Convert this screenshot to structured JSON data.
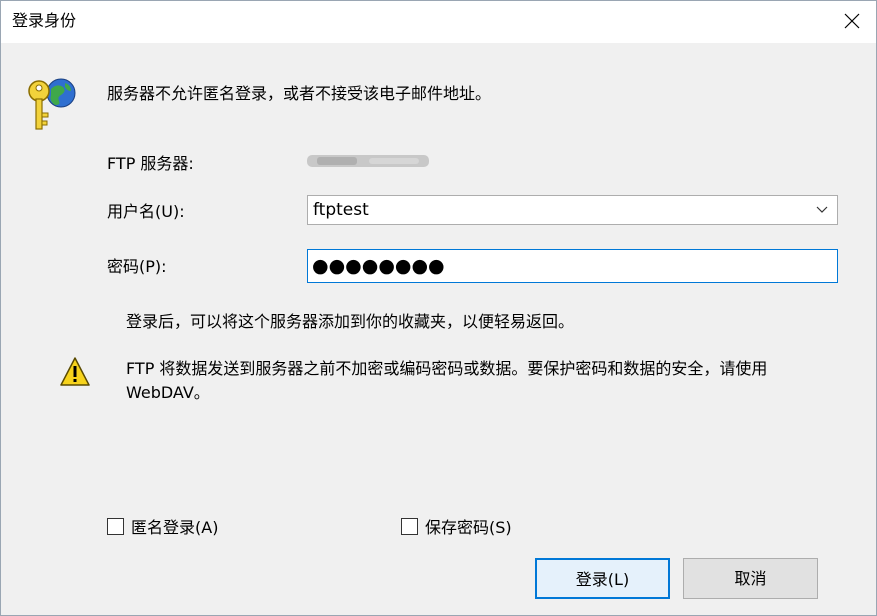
{
  "dialog": {
    "title": "登录身份"
  },
  "message": "服务器不允许匿名登录，或者不接受该电子邮件地址。",
  "fields": {
    "server_label": "FTP 服务器:",
    "username_label": "用户名(U):",
    "username_value": "ftptest",
    "password_label": "密码(P):",
    "password_value": "●●●●●●●●"
  },
  "save_note": "登录后，可以将这个服务器添加到你的收藏夹，以便轻易返回。",
  "warning": "FTP 将数据发送到服务器之前不加密或编码密码或数据。要保护密码和数据的安全，请使用 WebDAV。",
  "checkboxes": {
    "anonymous": {
      "label": "匿名登录(A)",
      "checked": false
    },
    "save_password": {
      "label": "保存密码(S)",
      "checked": false
    }
  },
  "buttons": {
    "login": "登录(L)",
    "cancel": "取消"
  },
  "colors": {
    "accent": "#0078d7",
    "background": "#f0f0f0"
  }
}
